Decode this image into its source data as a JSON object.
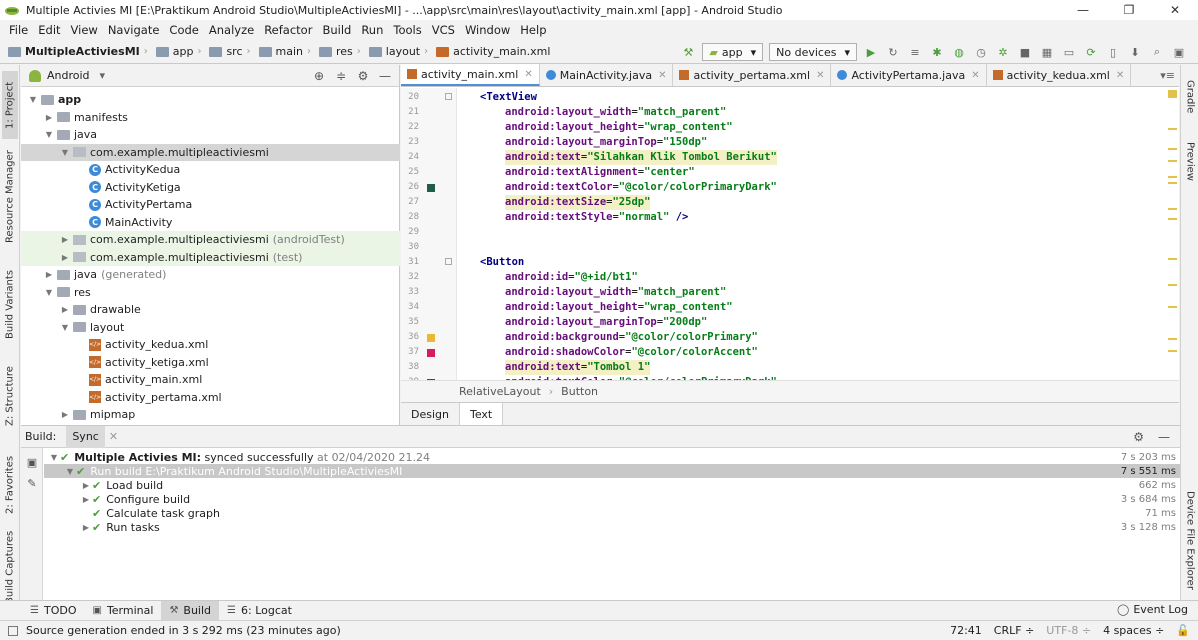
{
  "window": {
    "title": "Multiple Activies MI [E:\\Praktikum Android Studio\\MultipleActiviesMI] - ...\\app\\src\\main\\res\\layout\\activity_main.xml [app] - Android Studio",
    "controls": [
      "—",
      "❐",
      "✕"
    ]
  },
  "menu": [
    "File",
    "Edit",
    "View",
    "Navigate",
    "Code",
    "Analyze",
    "Refactor",
    "Build",
    "Run",
    "Tools",
    "VCS",
    "Window",
    "Help"
  ],
  "breadcrumbs": [
    "MultipleActiviesMI",
    "app",
    "src",
    "main",
    "res",
    "layout",
    "activity_main.xml"
  ],
  "run_config": {
    "module": "app",
    "device": "No devices"
  },
  "left_tabs": [
    "1: Project",
    "Resource Manager",
    "Build Variants",
    "Z: Structure",
    "2: Favorites",
    "Build Captures"
  ],
  "right_tabs": [
    "Gradle",
    "Preview",
    "Device File Explorer"
  ],
  "project": {
    "view": "Android",
    "tree": [
      {
        "label": "app",
        "depth": 0,
        "type": "folder",
        "expanded": true,
        "bold": true
      },
      {
        "label": "manifests",
        "depth": 1,
        "type": "folder",
        "expanded": false
      },
      {
        "label": "java",
        "depth": 1,
        "type": "folder",
        "expanded": true
      },
      {
        "label": "com.example.multipleactiviesmi",
        "depth": 2,
        "type": "pkg",
        "expanded": true,
        "selected": true
      },
      {
        "label": "ActivityKedua",
        "depth": 3,
        "type": "class"
      },
      {
        "label": "ActivityKetiga",
        "depth": 3,
        "type": "class"
      },
      {
        "label": "ActivityPertama",
        "depth": 3,
        "type": "class"
      },
      {
        "label": "MainActivity",
        "depth": 3,
        "type": "class"
      },
      {
        "label": "com.example.multipleactiviesmi",
        "suffix": "(androidTest)",
        "depth": 2,
        "type": "pkg",
        "expanded": false,
        "test": true
      },
      {
        "label": "com.example.multipleactiviesmi",
        "suffix": "(test)",
        "depth": 2,
        "type": "pkg",
        "expanded": false,
        "test": true
      },
      {
        "label": "java",
        "suffix": "(generated)",
        "depth": 1,
        "type": "folder",
        "expanded": false
      },
      {
        "label": "res",
        "depth": 1,
        "type": "folder",
        "expanded": true
      },
      {
        "label": "drawable",
        "depth": 2,
        "type": "folder",
        "expanded": false
      },
      {
        "label": "layout",
        "depth": 2,
        "type": "folder",
        "expanded": true
      },
      {
        "label": "activity_kedua.xml",
        "depth": 3,
        "type": "xml"
      },
      {
        "label": "activity_ketiga.xml",
        "depth": 3,
        "type": "xml"
      },
      {
        "label": "activity_main.xml",
        "depth": 3,
        "type": "xml"
      },
      {
        "label": "activity_pertama.xml",
        "depth": 3,
        "type": "xml"
      },
      {
        "label": "mipmap",
        "depth": 2,
        "type": "folder",
        "expanded": false
      }
    ]
  },
  "editor": {
    "tabs": [
      {
        "label": "activity_main.xml",
        "kind": "xml",
        "active": true
      },
      {
        "label": "MainActivity.java",
        "kind": "class"
      },
      {
        "label": "activity_pertama.xml",
        "kind": "xml"
      },
      {
        "label": "ActivityPertama.java",
        "kind": "class"
      },
      {
        "label": "activity_kedua.xml",
        "kind": "xml"
      }
    ],
    "lines": [
      {
        "n": "20",
        "indent": 1,
        "tag": "<TextView"
      },
      {
        "n": "21",
        "indent": 2,
        "attr": "android:layout_width",
        "val": "\"match_parent\""
      },
      {
        "n": "22",
        "indent": 2,
        "attr": "android:layout_height",
        "val": "\"wrap_content\""
      },
      {
        "n": "23",
        "indent": 2,
        "attr": "android:layout_marginTop",
        "val": "\"150dp\""
      },
      {
        "n": "24",
        "indent": 2,
        "attr": "android:text",
        "val": "\"Silahkan Klik Tombol Berikut\"",
        "hl": true
      },
      {
        "n": "25",
        "indent": 2,
        "attr": "android:textAlignment",
        "val": "\"center\""
      },
      {
        "n": "26",
        "indent": 2,
        "attr": "android:textColor",
        "val": "\"@color/colorPrimaryDark\"",
        "mark": "#1f5f4a"
      },
      {
        "n": "27",
        "indent": 2,
        "attr": "android:textSize",
        "val": "\"25dp\"",
        "hl": true
      },
      {
        "n": "28",
        "indent": 2,
        "attr": "android:textStyle",
        "val": "\"normal\"",
        "end": " />"
      },
      {
        "n": "29",
        "indent": 0
      },
      {
        "n": "30",
        "indent": 0
      },
      {
        "n": "31",
        "indent": 1,
        "tag": "<Button"
      },
      {
        "n": "32",
        "indent": 2,
        "attr": "android:id",
        "val": "\"@+id/bt1\""
      },
      {
        "n": "33",
        "indent": 2,
        "attr": "android:layout_width",
        "val": "\"match_parent\""
      },
      {
        "n": "34",
        "indent": 2,
        "attr": "android:layout_height",
        "val": "\"wrap_content\""
      },
      {
        "n": "35",
        "indent": 2,
        "attr": "android:layout_marginTop",
        "val": "\"200dp\""
      },
      {
        "n": "36",
        "indent": 2,
        "attr": "android:background",
        "val": "\"@color/colorPrimary\"",
        "mark": "#e8b936"
      },
      {
        "n": "37",
        "indent": 2,
        "attr": "android:shadowColor",
        "val": "\"@color/colorAccent\"",
        "mark": "#d81b60"
      },
      {
        "n": "38",
        "indent": 2,
        "attr": "android:text",
        "val": "\"Tombol 1\"",
        "hl": true
      },
      {
        "n": "39",
        "indent": 2,
        "attr": "android:textColor",
        "val": "\"@color/colorPrimaryDark\"",
        "mark": "#1f5f4a"
      }
    ],
    "crumbs": [
      "RelativeLayout",
      "Button"
    ],
    "view_tabs": [
      {
        "label": "Design"
      },
      {
        "label": "Text",
        "active": true
      }
    ]
  },
  "build": {
    "label": "Build:",
    "sync_tab": "Sync",
    "rows": [
      {
        "depth": 0,
        "arrow": "▼",
        "check": true,
        "bold": "Multiple Activies MI:",
        "text": " synced successfully",
        "muted": " at 02/04/2020 21.24",
        "time": "7 s 203 ms"
      },
      {
        "depth": 1,
        "arrow": "▼",
        "check": true,
        "text": "Run build E:\\Praktikum Android Studio\\MultipleActiviesMI",
        "time": "7 s 551 ms",
        "selected": true
      },
      {
        "depth": 2,
        "arrow": "▶",
        "check": true,
        "text": "Load build",
        "time": "662 ms"
      },
      {
        "depth": 2,
        "arrow": "▶",
        "check": true,
        "text": "Configure build",
        "time": "3 s 684 ms"
      },
      {
        "depth": 2,
        "arrow": "",
        "check": true,
        "text": "Calculate task graph",
        "time": "71 ms"
      },
      {
        "depth": 2,
        "arrow": "▶",
        "check": true,
        "text": "Run tasks",
        "time": "3 s 128 ms"
      }
    ]
  },
  "bottom_tabs": [
    {
      "label": "TODO",
      "icon": "☰"
    },
    {
      "label": "Terminal",
      "icon": "▣"
    },
    {
      "label": "Build",
      "icon": "⚒",
      "active": true
    },
    {
      "label": "6: Logcat",
      "icon": "☰"
    }
  ],
  "event_log": "Event Log",
  "status": {
    "message": "Source generation ended in 3 s 292 ms (23 minutes ago)",
    "position": "72:41",
    "line_sep": "CRLF ÷",
    "encoding": "UTF-8 ÷",
    "indent": "4 spaces ÷"
  }
}
